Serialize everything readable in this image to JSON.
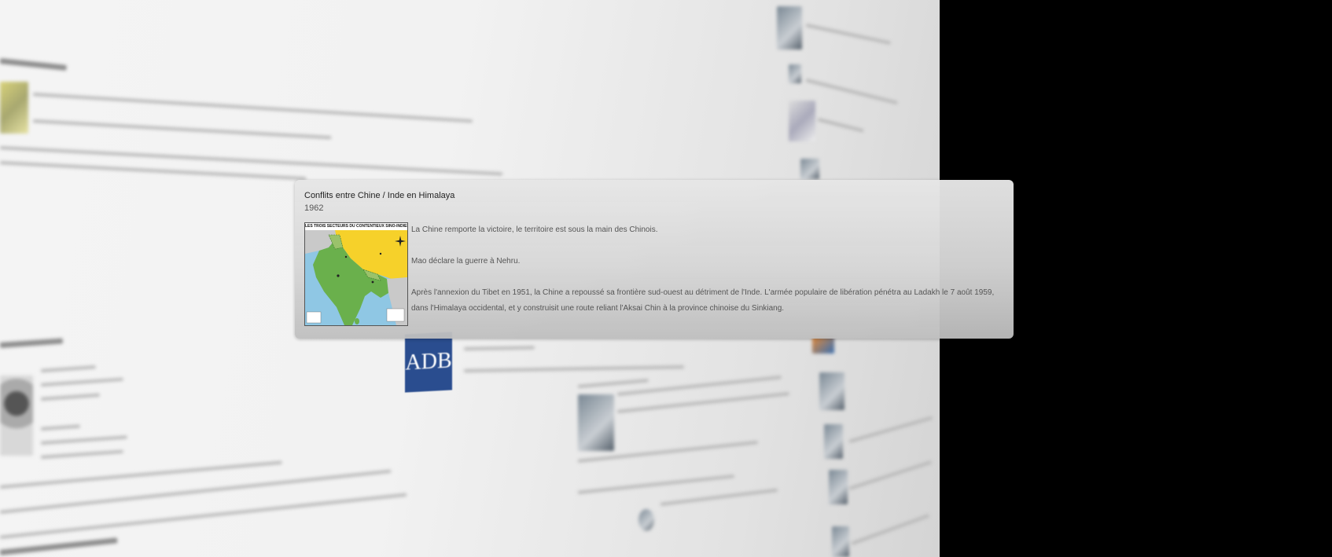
{
  "event": {
    "title": "Conflits entre Chine / Inde en Himalaya",
    "year": "1962",
    "map_caption": "LES TROIS SECTEURS DU CONTENTIEUX SINO-INDIEN",
    "paragraphs": [
      "La Chine remporte la victoire, le territoire est sous la main des Chinois.",
      "Mao déclare la guerre à Nehru.",
      "Après l'annexion du Tibet en 1951, la Chine a repoussé sa frontière sud-ouest au détriment de l'Inde. L'armée populaire de libération pénétra au Ladakh le 7 août 1959, dans l'Himalaya occidental, et y construisit une route reliant l'Aksai Chin à la province chinoise du Sinkiang."
    ]
  },
  "background": {
    "logo_text": "ADB"
  }
}
